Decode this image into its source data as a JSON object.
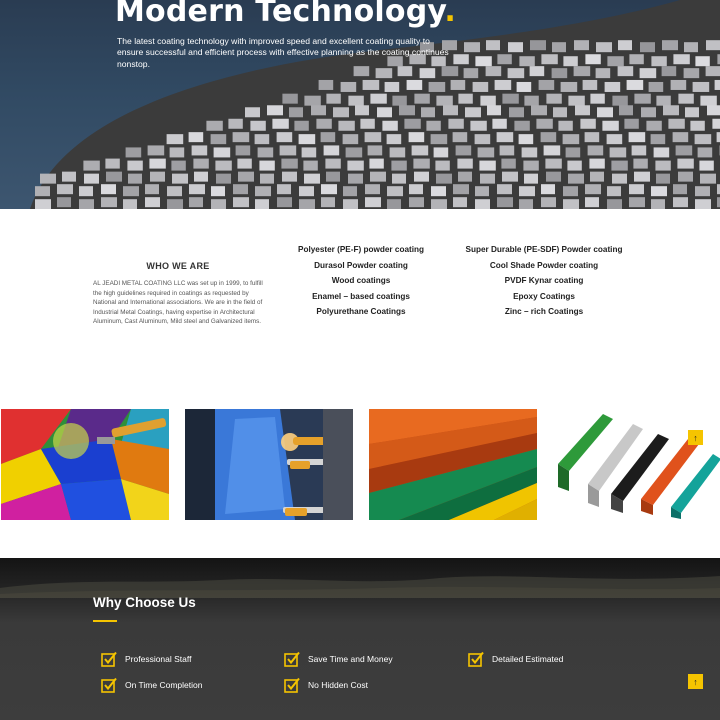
{
  "hero": {
    "title": "Modern Technology",
    "title_dot": ".",
    "subtitle": "The latest coating technology with improved speed and excellent coating quality to ensure successful and efficient process with effective planning as the coating continues nonstop."
  },
  "about": {
    "heading": "WHO WE ARE",
    "text": "AL JEADI METAL COATING LLC was set up in 1999, to fulfill the high guidelines required in coatings as requested by National and International associations. We are in the field of Industrial Metal Coatings, having expertise in Architectural Aluminum, Cast Aluminum, Mild steel and Galvanized items.",
    "coatings_left": [
      "Polyester (PE-F) powder coating",
      "Durasol Powder coating",
      "Wood coatings",
      "Enamel – based coatings",
      "Polyurethane Coatings"
    ],
    "coatings_right": [
      "Super Durable (PE-SDF) Powder coating",
      "Cool Shade Powder coating",
      "PVDF Kynar coating",
      "Epoxy Coatings",
      "Zinc – rich Coatings"
    ]
  },
  "gallery": {
    "images": [
      "powder-colors-image",
      "spray-booth-image",
      "colored-profiles-image",
      "aluminum-extrusions-image"
    ]
  },
  "why": {
    "heading": "Why Choose Us",
    "features": [
      "Professional Staff",
      "Save Time and Money",
      "Detailed Estimated",
      "On Time Completion",
      "No Hidden Cost"
    ]
  },
  "scroll_top": {
    "icon": "arrow-up-icon",
    "glyph": "↑"
  },
  "colors": {
    "accent": "#f5c400",
    "dark": "#3d3d3d",
    "hero_sky": "#2f4660"
  }
}
